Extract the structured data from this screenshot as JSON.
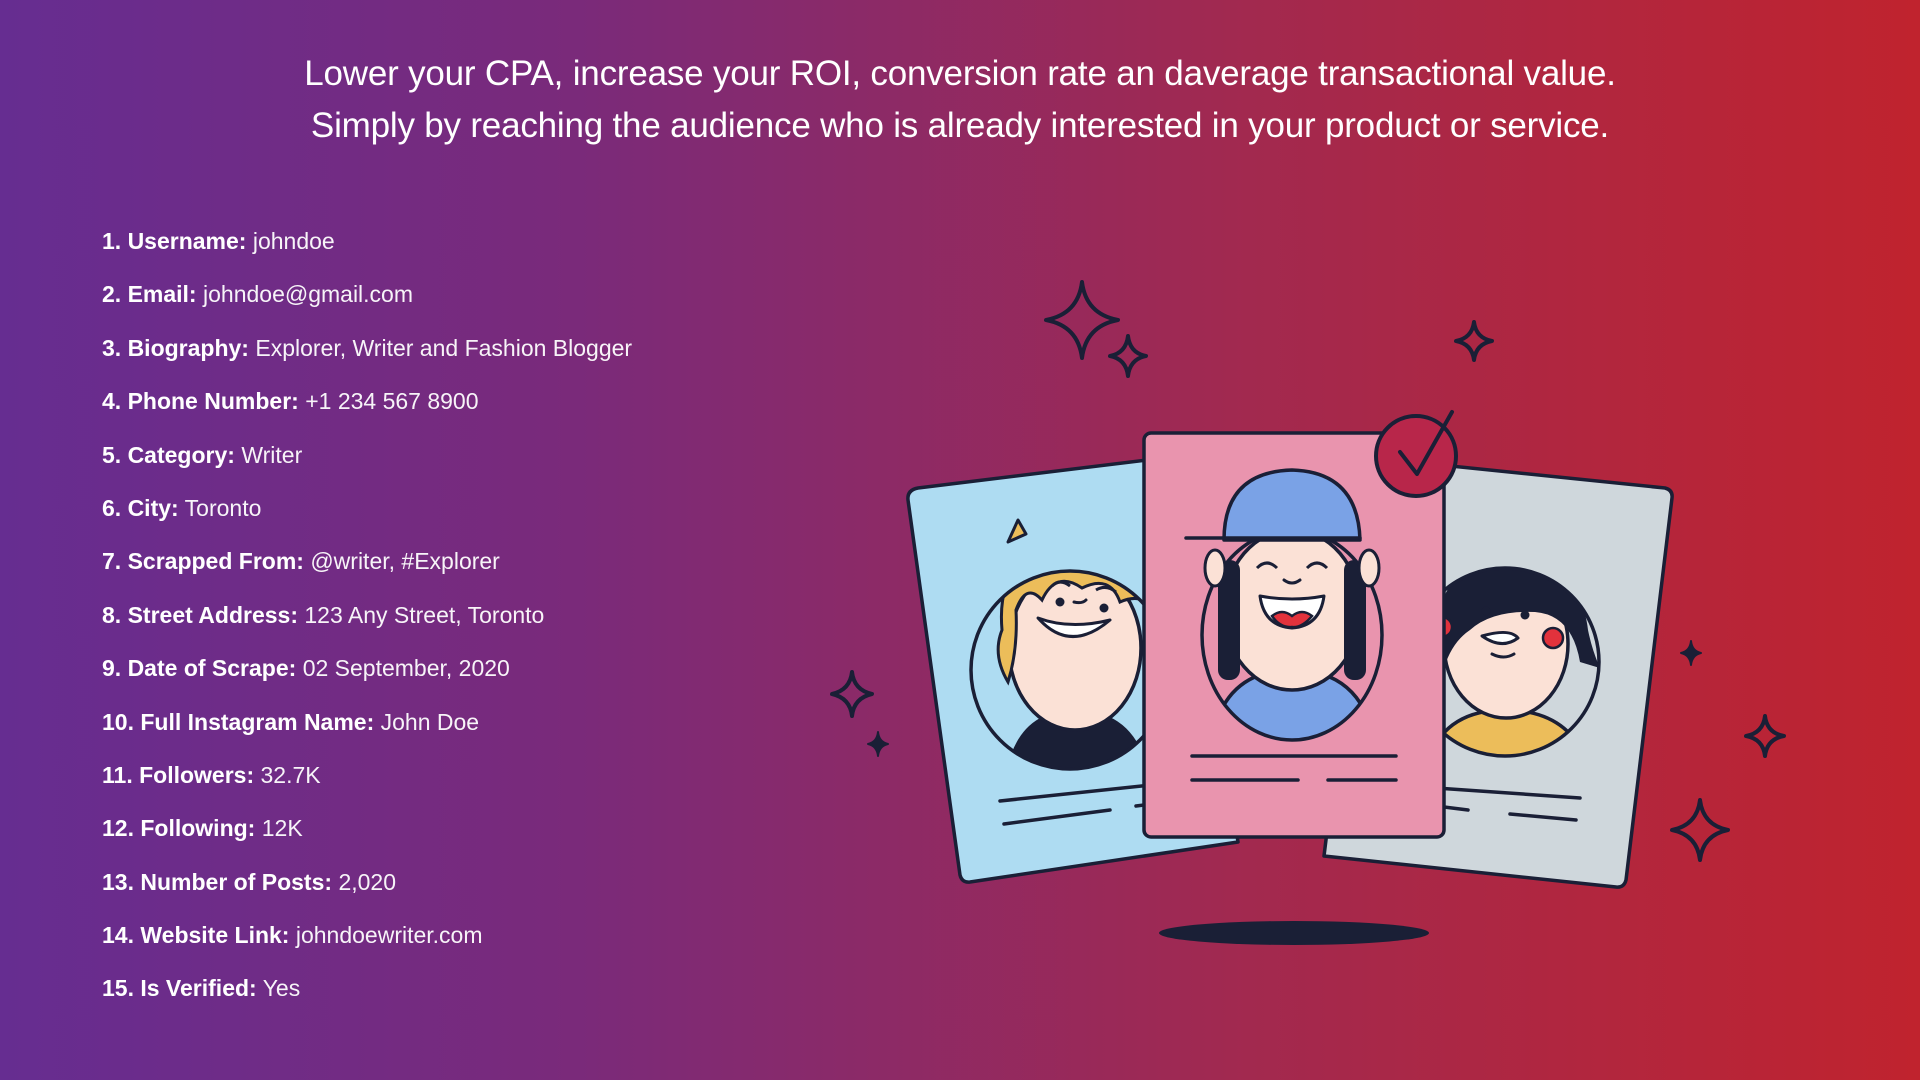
{
  "headline": {
    "line1": "Lower your CPA, increase your ROI, conversion rate an daverage transactional value.",
    "line2": "Simply by reaching the audience who is already interested in your product or service."
  },
  "fields": [
    {
      "label": "1. Username:",
      "value": "johndoe"
    },
    {
      "label": "2. Email:",
      "value": "johndoe@gmail.com"
    },
    {
      "label": "3. Biography:",
      "value": "Explorer, Writer and Fashion Blogger"
    },
    {
      "label": "4. Phone Number:",
      "value": "+1 234 567 8900"
    },
    {
      "label": "5. Category:",
      "value": "Writer"
    },
    {
      "label": "6. City:",
      "value": "Toronto"
    },
    {
      "label": "7. Scrapped From:",
      "value": "@writer, #Explorer"
    },
    {
      "label": "8. Street Address:",
      "value": "123 Any Street, Toronto"
    },
    {
      "label": "9. Date of Scrape:",
      "value": "02 September, 2020"
    },
    {
      "label": "10. Full Instagram Name:",
      "value": "John Doe"
    },
    {
      "label": "11. Followers:",
      "value": "32.7K"
    },
    {
      "label": "12. Following:",
      "value": "12K"
    },
    {
      "label": "13. Number of Posts:",
      "value": "2,020"
    },
    {
      "label": "14. Website Link:",
      "value": "johndoewriter.com"
    },
    {
      "label": "15. Is Verified:",
      "value": "Yes"
    }
  ],
  "colors": {
    "gradient_start": "#662d91",
    "gradient_end": "#c0232e",
    "outline": "#1a1f36",
    "card_left": "#aedcf2",
    "card_center": "#e994ae",
    "card_right": "#cfd7dc",
    "skin": "#fbe1d6",
    "blond_hair": "#ecbd5a",
    "cap": "#7aa2e6",
    "accent_red": "#e2323c"
  },
  "illustration": {
    "icons": [
      "profile-card-icon",
      "checkmark-badge-icon",
      "sparkle-icon"
    ]
  }
}
